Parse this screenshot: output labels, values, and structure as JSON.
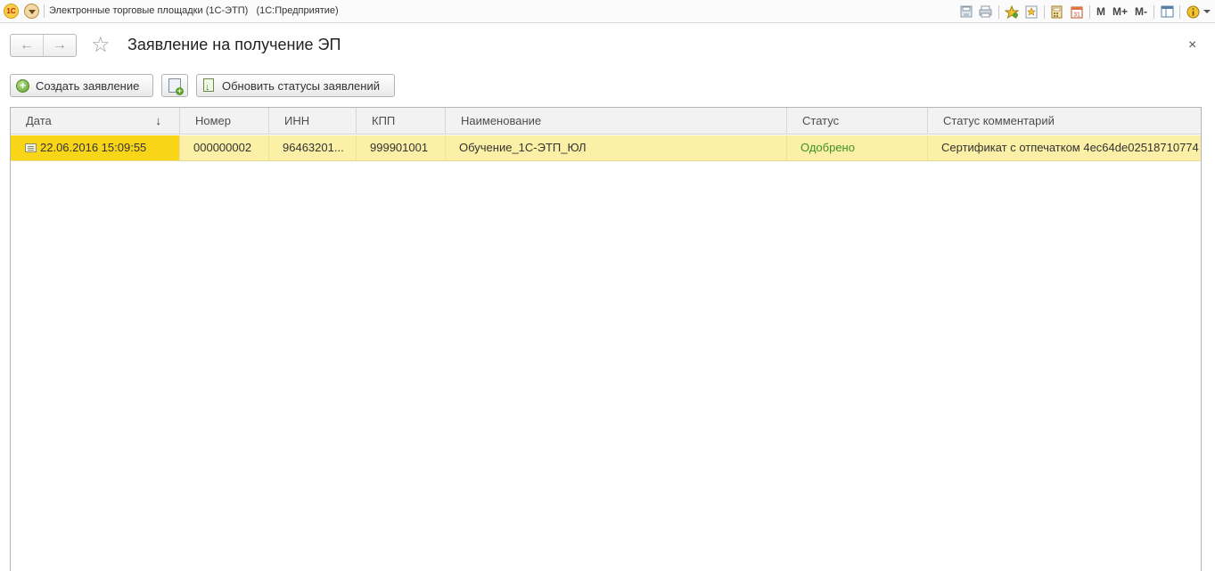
{
  "window": {
    "app_logo": "1С",
    "title": "Электронные торговые площадки (1С-ЭТП)   (1С:Предприятие)",
    "toolbar_icons": [
      "save-icon",
      "print-icon",
      "favorites-icon",
      "bookmark-icon",
      "calculator-icon",
      "calendar-icon"
    ],
    "memory_buttons": [
      "M",
      "M+",
      "M-"
    ],
    "calendar_day": "31"
  },
  "form": {
    "title": "Заявление на получение ЭП",
    "back": "←",
    "forward": "→",
    "star": "☆",
    "close": "×"
  },
  "toolbar": {
    "create_label": "Создать заявление",
    "refresh_label": "Обновить статусы заявлений"
  },
  "table": {
    "columns": [
      "Дата",
      "Номер",
      "ИНН",
      "КПП",
      "Наименование",
      "Статус",
      "Статус комментарий"
    ],
    "sort_indicator": "↓",
    "rows": [
      {
        "date": "22.06.2016 15:09:55",
        "number": "000000002",
        "inn": "96463201...",
        "kpp": "999901001",
        "name": "Обучение_1С-ЭТП_ЮЛ",
        "status": "Одобрено",
        "comment": "Сертификат с отпечатком 4ec64de02518710774"
      }
    ]
  },
  "colors": {
    "selected_row": "#fbf0a6",
    "selected_cell": "#f9d517",
    "status_ok": "#3b9325"
  }
}
